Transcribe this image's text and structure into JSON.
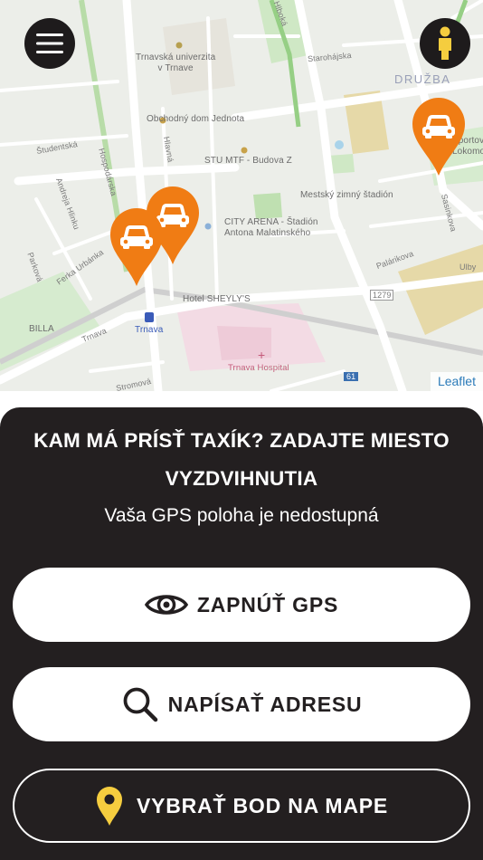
{
  "map": {
    "district_label": "DRUŽBA",
    "attribution": "Leaflet",
    "labels": {
      "university": "Trnavská univerzita\nv Trnave",
      "jednota": "Obchodný dom Jednota",
      "stu": "STU MTF - Budova Z",
      "city_arena": "CITY ARENA - Štadión\nAntona Malatinského",
      "winter_stadium": "Mestský zimný štadión",
      "hotel": "Hotel SHEYLY'S",
      "trnava_station": "Trnava",
      "hospital": "Trnava Hospital",
      "billa": "BILLA",
      "sportovy": "Športový\nLokomotíva",
      "road_1279": "1279",
      "road_61": "61",
      "street_studentska": "Študentská",
      "street_hlavna": "Hlavná",
      "street_hospodarska": "Hospodárska",
      "street_andreja": "Andreja Hlinku",
      "street_ferka": "Ferka Urbánka",
      "street_parkova": "Parková",
      "street_starohajska": "Starohájska",
      "street_sasinkova": "Sasinkova",
      "street_palarikova": "Palárikova",
      "street_strojarska": "Stromová",
      "street_trnava": "Trnava",
      "street_hviezd": "Hlboká",
      "street_ulo": "Ulby"
    },
    "marker_color": "#f07c14",
    "user_button_color": "#f5cd3f"
  },
  "panel": {
    "title": "KAM MÁ PRÍSŤ TAXÍK? ZADAJTE MIESTO VYZDVIHNUTIA",
    "subtitle": "Vaša GPS poloha je nedostupná",
    "gps_button_label": "ZAPNÚŤ GPS",
    "address_button_label": "NAPÍSAŤ ADRESU",
    "map_point_button_label": "VYBRAŤ BOD NA MAPE",
    "accent_yellow": "#f5cd3f",
    "panel_color": "#231f20"
  }
}
